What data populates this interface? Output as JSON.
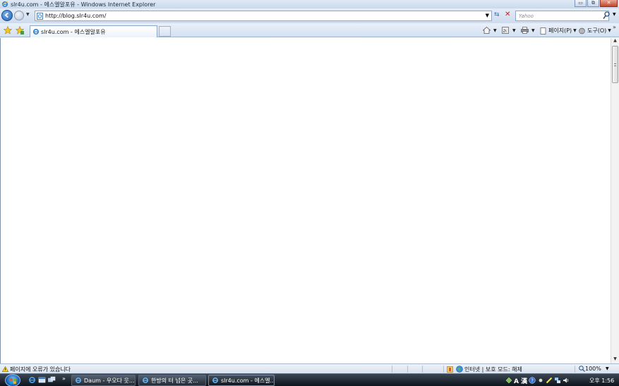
{
  "window": {
    "title": "slr4u.com - 에스엘알포유 - Windows Internet Explorer",
    "buttons": {
      "minimize": "▭",
      "maximize": "⧉",
      "close": "✕"
    }
  },
  "address_bar": {
    "url": "http://blog.slr4u.com/",
    "search_placeholder": "Yahoo"
  },
  "tabs": [
    {
      "label": "slr4u.com - 에스엘알포유",
      "active": true
    }
  ],
  "command_bar": {
    "home_icon": "home-icon",
    "feeds_icon": "rss-icon",
    "print_icon": "printer-icon",
    "page_label": "페이지(P)",
    "tools_label": "도구(O)",
    "more": "»"
  },
  "status_bar": {
    "message": "페이지에 오류가 있습니다",
    "zone": "인터넷 | 보호 모드: 해제",
    "zoom": "100%"
  },
  "taskbar": {
    "more": "»",
    "tasks": [
      {
        "label": "Daum - 우오다 웃...",
        "active": false
      },
      {
        "label": "한방의 터 넘은 곳...",
        "active": false
      },
      {
        "label": "slr4u.com - 에스엘...",
        "active": true
      }
    ],
    "tray_ime": "A 漢",
    "clock": "오후 1:56"
  },
  "colors": {
    "chrome_light": "#dfe9f5",
    "chrome_dark": "#c9d9ec",
    "taskbar": "#0d141d",
    "close_button": "#c4452b"
  }
}
